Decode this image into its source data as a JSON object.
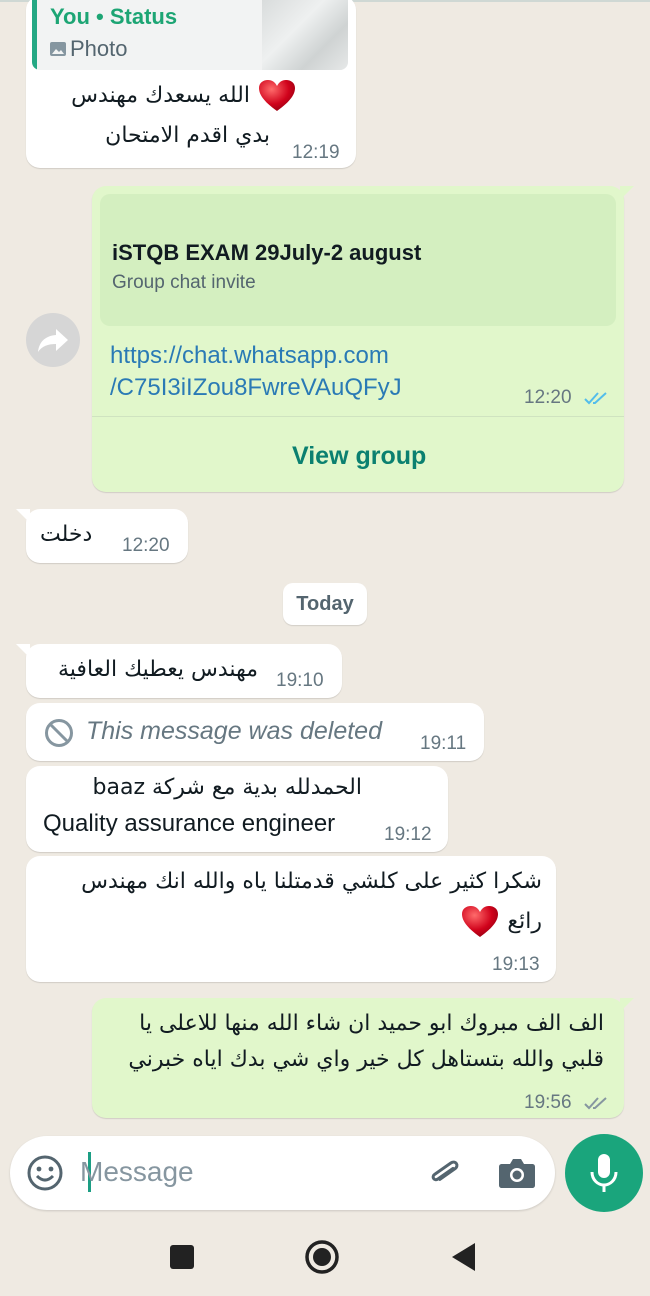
{
  "colors": {
    "accent": "#1aa57c",
    "incoming": "#ffffff",
    "outgoing": "#e1f7cb",
    "link": "#2a7ab5",
    "read_ticks": "#53bdeb",
    "sent_ticks": "#8696a0"
  },
  "messages": [
    {
      "id": "m1",
      "quote_author": "You • Status",
      "quote_kind": "Photo",
      "line1": "الله يسعدك مهندس",
      "line2": "بدي اقدم الامتحان",
      "time": "12:19"
    },
    {
      "id": "m2",
      "invite_title": "iSTQB EXAM 29July-2 august",
      "invite_subtitle": "Group chat invite",
      "link_line1": "https://chat.whatsapp.com",
      "link_line2": "/C75I3iIZou8FwreVAuQFyJ",
      "time": "12:20",
      "action": "View group"
    },
    {
      "id": "m3",
      "text": "دخلت",
      "time": "12:20"
    },
    {
      "id": "m4",
      "text": "مهندس يعطيك العافية",
      "time": "19:10"
    },
    {
      "id": "m5",
      "text": "This message was deleted",
      "time": "19:11"
    },
    {
      "id": "m6",
      "line1": "الحمدلله بدية مع شركة baaz",
      "line2": "Quality assurance engineer",
      "time": "19:12"
    },
    {
      "id": "m7",
      "line1": "شكرا كثير على كلشي قدمتلنا ياه والله انك مهندس",
      "line2": "رائع",
      "time": "19:13"
    },
    {
      "id": "m8",
      "line1": "الف الف مبروك ابو حميد ان شاء الله منها للاعلى يا",
      "line2": "قلبي والله بتستاهل كل خير واي شي بدك اياه خبرني",
      "time": "19:56"
    }
  ],
  "date_separator": "Today",
  "composer": {
    "placeholder": "Message"
  },
  "icons": [
    "forward-icon",
    "emoji-icon",
    "attach-icon",
    "camera-icon",
    "mic-icon",
    "nav-square-icon",
    "nav-home-icon",
    "nav-back-icon",
    "photo-icon",
    "deleted-icon",
    "heart-icon"
  ]
}
